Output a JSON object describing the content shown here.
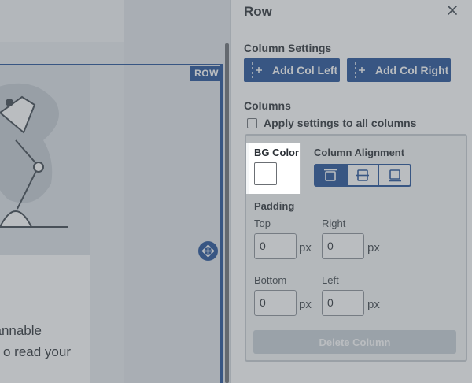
{
  "canvas": {
    "row_tag": "ROW",
    "body_text_line1": "annable",
    "body_text_line2": "o read your"
  },
  "panel": {
    "title": "Row",
    "column_settings": {
      "label": "Column Settings",
      "add_left_label": "Add Col Left",
      "add_right_label": "Add Col Right"
    },
    "columns": {
      "label": "Columns",
      "apply_all_label": "Apply settings to all columns",
      "apply_all_checked": false,
      "bg_color_label": "BG Color",
      "bg_color_value": "#ffffff",
      "alignment_label": "Column Alignment",
      "alignment_options": [
        "top-align-icon",
        "middle-align-icon",
        "bottom-align-icon"
      ],
      "alignment_selected": "top",
      "padding_label": "Padding",
      "padding": {
        "top_label": "Top",
        "top_value": "0",
        "right_label": "Right",
        "right_value": "0",
        "bottom_label": "Bottom",
        "bottom_value": "0",
        "left_label": "Left",
        "left_value": "0",
        "unit": "px"
      },
      "delete_label": "Delete Column"
    }
  },
  "colors": {
    "accent": "#1f4e96",
    "panel_bg": "#ffffff",
    "overlay": "rgba(90,98,106,0.42)"
  }
}
